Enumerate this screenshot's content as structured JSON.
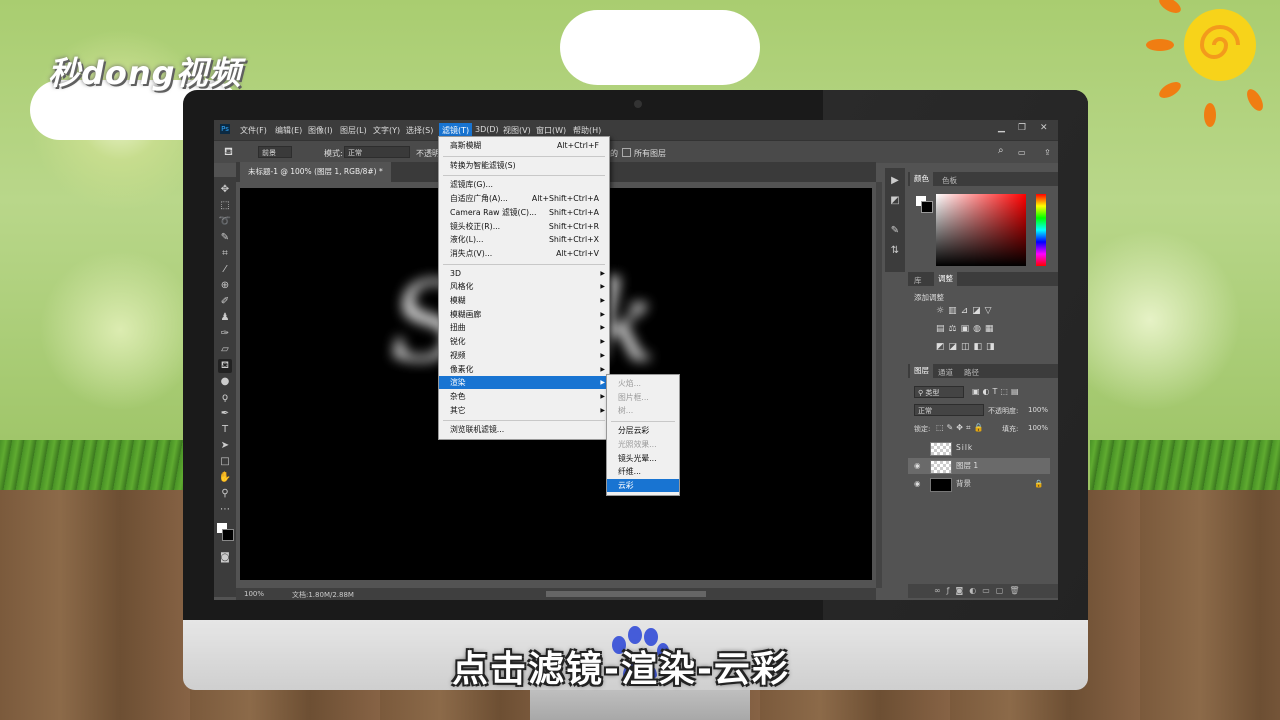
{
  "brand": {
    "logo_text": "秒dong视频"
  },
  "caption": "点击滤镜-渲染-云彩",
  "app": {
    "menubar": [
      "文件(F)",
      "编辑(E)",
      "图像(I)",
      "图层(L)",
      "文字(Y)",
      "选择(S)",
      "滤镜(T)",
      "3D(D)",
      "视图(V)",
      "窗口(W)",
      "帮助(H)"
    ],
    "ps_logo": "Ps",
    "options": {
      "preset": "前景",
      "mode_label": "模式:",
      "mode_value": "正常",
      "opacity_label": "不透明",
      "all_layers": "所有图层",
      "partial": "的"
    },
    "doc_tab": "未标题-1 @ 100% (图层 1, RGB/8#) *",
    "canvas_text": "Silk",
    "status": {
      "zoom": "100%",
      "doc": "文档:1.80M/2.88M"
    }
  },
  "filter_menu": {
    "items": [
      {
        "label": "高斯模糊",
        "shortcut": "Alt+Ctrl+F"
      },
      {
        "sep": true
      },
      {
        "label": "转换为智能滤镜(S)",
        "shortcut": ""
      },
      {
        "sep": true
      },
      {
        "label": "滤镜库(G)...",
        "shortcut": ""
      },
      {
        "label": "自适应广角(A)...",
        "shortcut": "Alt+Shift+Ctrl+A"
      },
      {
        "label": "Camera Raw 滤镜(C)...",
        "shortcut": "Shift+Ctrl+A"
      },
      {
        "label": "镜头校正(R)...",
        "shortcut": "Shift+Ctrl+R"
      },
      {
        "label": "液化(L)...",
        "shortcut": "Shift+Ctrl+X"
      },
      {
        "label": "消失点(V)...",
        "shortcut": "Alt+Ctrl+V"
      },
      {
        "sep": true
      },
      {
        "label": "3D",
        "sub": true
      },
      {
        "label": "风格化",
        "sub": true
      },
      {
        "label": "模糊",
        "sub": true
      },
      {
        "label": "模糊画廊",
        "sub": true
      },
      {
        "label": "扭曲",
        "sub": true
      },
      {
        "label": "锐化",
        "sub": true
      },
      {
        "label": "视频",
        "sub": true
      },
      {
        "label": "像素化",
        "sub": true
      },
      {
        "label": "渲染",
        "sub": true,
        "selected": true
      },
      {
        "label": "杂色",
        "sub": true
      },
      {
        "label": "其它",
        "sub": true
      },
      {
        "sep": true
      },
      {
        "label": "浏览联机滤镜...",
        "shortcut": ""
      }
    ]
  },
  "render_submenu": {
    "items": [
      {
        "label": "火焰...",
        "disabled": true
      },
      {
        "label": "图片框...",
        "disabled": true
      },
      {
        "label": "树...",
        "disabled": true
      },
      {
        "sep": true
      },
      {
        "label": "分层云彩"
      },
      {
        "label": "光照效果...",
        "disabled": true
      },
      {
        "label": "镜头光晕..."
      },
      {
        "label": "纤维..."
      },
      {
        "label": "云彩",
        "selected": true
      }
    ]
  },
  "panels": {
    "color_tabs": [
      "颜色",
      "色板"
    ],
    "adj_tabs": [
      "库",
      "调整"
    ],
    "adj_title": "添加调整",
    "layers_tabs": [
      "图层",
      "通道",
      "路径"
    ],
    "kind": "类型",
    "blend": "正常",
    "opacity_label": "不透明度:",
    "opacity": "100%",
    "lock_label": "锁定:",
    "fill_label": "填充:",
    "fill": "100%",
    "layers": [
      {
        "name": "Silk",
        "visible": false
      },
      {
        "name": "图层 1",
        "visible": true
      },
      {
        "name": "背景",
        "visible": true,
        "locked": true
      }
    ]
  },
  "colors": {
    "accent": "#1874d2",
    "ps_bg": "#535353",
    "ps_dark": "#3c3c3c"
  }
}
